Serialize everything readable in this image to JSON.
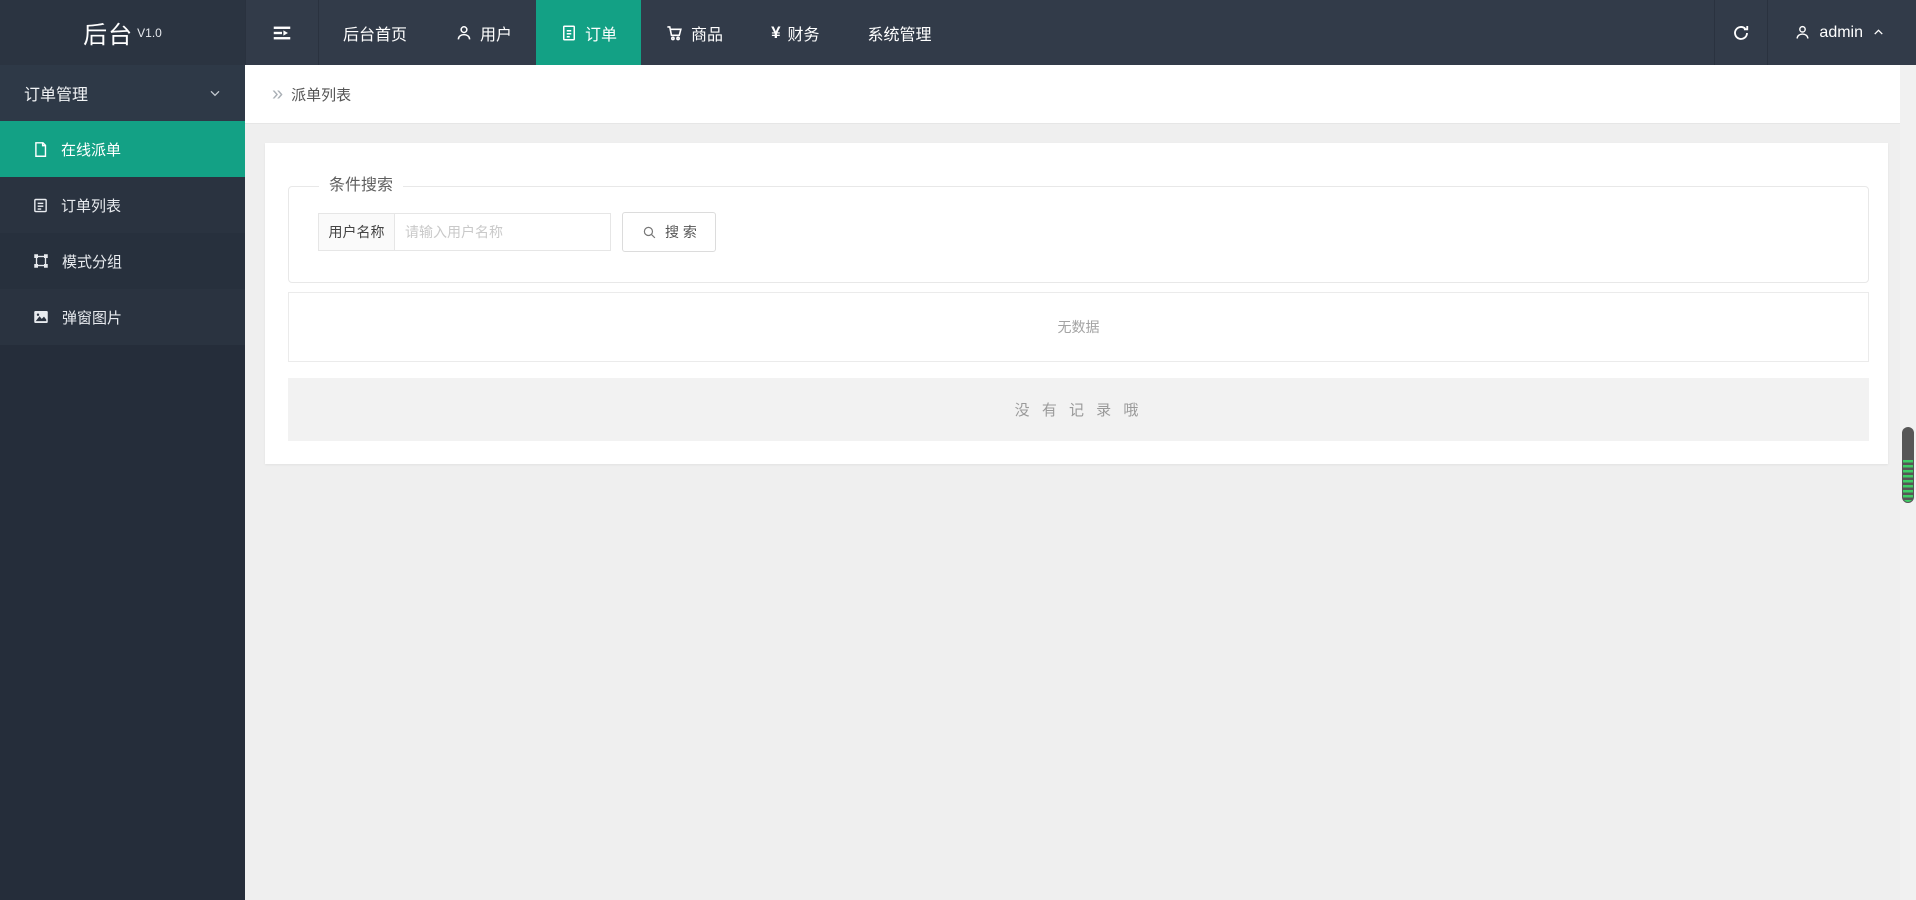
{
  "app": {
    "title": "后台",
    "version": "V1.0"
  },
  "topnav": {
    "items": [
      {
        "label": "后台首页",
        "icon": null,
        "active": false
      },
      {
        "label": "用户",
        "icon": "user-icon",
        "active": false
      },
      {
        "label": "订单",
        "icon": "document-icon",
        "active": true
      },
      {
        "label": "商品",
        "icon": "cart-icon",
        "active": false
      },
      {
        "label": "财务",
        "icon": "yen-icon",
        "yen_glyph": "¥",
        "active": false
      },
      {
        "label": "系统管理",
        "icon": null,
        "active": false
      }
    ],
    "hamburger_icon": "menu-collapse-icon",
    "refresh_icon": "refresh-icon",
    "user": {
      "name": "admin",
      "icon": "user-icon",
      "chevron_icon": "chevron-up-icon"
    }
  },
  "sidebar": {
    "group": {
      "label": "订单管理",
      "chevron_icon": "chevron-down-icon"
    },
    "items": [
      {
        "label": "在线派单",
        "icon": "page-icon",
        "active": true
      },
      {
        "label": "订单列表",
        "icon": "list-form-icon",
        "active": false
      },
      {
        "label": "模式分组",
        "icon": "object-group-icon",
        "active": false
      },
      {
        "label": "弹窗图片",
        "icon": "image-icon",
        "active": false
      }
    ]
  },
  "breadcrumb": {
    "separator": "»",
    "title": "派单列表"
  },
  "search_panel": {
    "legend": "条件搜索",
    "field_label": "用户名称",
    "input_value": "",
    "input_placeholder": "请输入用户名称",
    "search_button": "搜 索",
    "search_icon": "magnifier-icon"
  },
  "results": {
    "empty_table_text": "无数据",
    "no_record_text": "没 有 记 录 哦"
  },
  "colors": {
    "accent_teal": "#13a185",
    "topbar_bg": "#323b49",
    "logo_bg": "#2b3441",
    "sidebar_bg": "#252d3a",
    "page_bg": "#efefef",
    "scroll_thumb": "#575757",
    "scroll_stripe": "#3fce66"
  }
}
